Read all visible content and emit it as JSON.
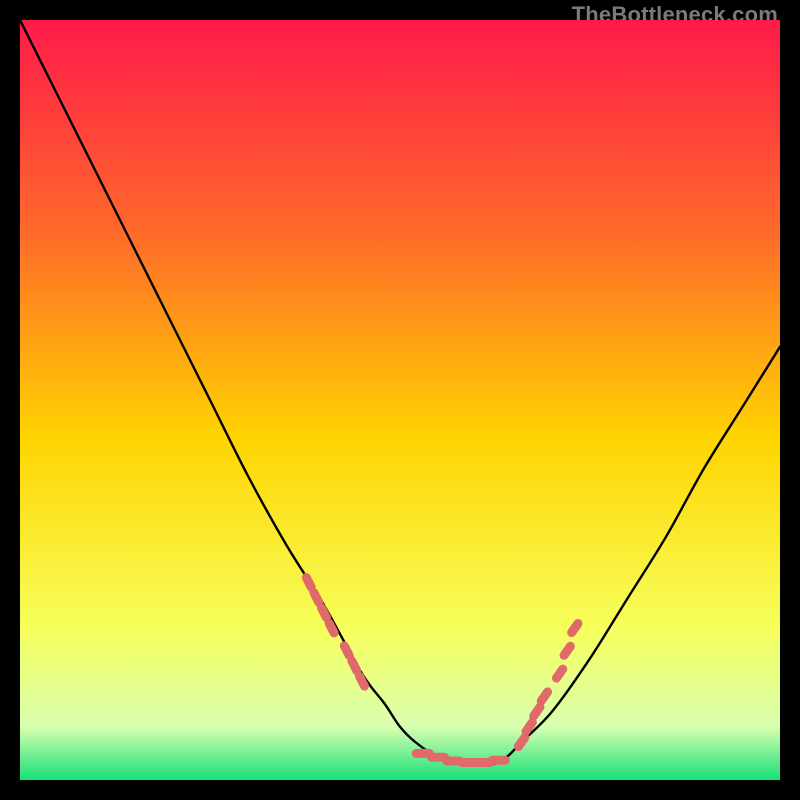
{
  "watermark": "TheBottleneck.com",
  "colors": {
    "gradient_top": "#ff1a4b",
    "gradient_upper_mid": "#ff6a2a",
    "gradient_mid": "#ffd400",
    "gradient_lower_mid": "#f6ff5b",
    "gradient_near_bottom": "#d9ffb0",
    "gradient_bottom": "#17e07a",
    "curve": "#000000",
    "marker": "#e06a6a",
    "frame": "#000000"
  },
  "chart_data": {
    "type": "line",
    "title": "",
    "xlabel": "",
    "ylabel": "",
    "xlim": [
      0,
      100
    ],
    "ylim": [
      0,
      100
    ],
    "grid": false,
    "legend": false,
    "series": [
      {
        "name": "bottleneck-curve",
        "x": [
          0,
          5,
          10,
          15,
          20,
          25,
          30,
          35,
          40,
          45,
          48,
          50,
          52,
          55,
          58,
          60,
          62,
          64,
          66,
          70,
          75,
          80,
          85,
          90,
          95,
          100
        ],
        "y": [
          100,
          90,
          80,
          70,
          60,
          50,
          40,
          31,
          23,
          14,
          10,
          7,
          5,
          3,
          2,
          2,
          2,
          3,
          5,
          9,
          16,
          24,
          32,
          41,
          49,
          57
        ]
      }
    ],
    "marker_clusters": [
      {
        "name": "left-cluster",
        "points": [
          {
            "x": 38,
            "y": 26
          },
          {
            "x": 39,
            "y": 24
          },
          {
            "x": 40,
            "y": 22
          },
          {
            "x": 41,
            "y": 20
          },
          {
            "x": 43,
            "y": 17
          },
          {
            "x": 44,
            "y": 15
          },
          {
            "x": 45,
            "y": 13
          }
        ]
      },
      {
        "name": "bottom-cluster",
        "points": [
          {
            "x": 53,
            "y": 3.5
          },
          {
            "x": 55,
            "y": 3.0
          },
          {
            "x": 57,
            "y": 2.5
          },
          {
            "x": 59,
            "y": 2.3
          },
          {
            "x": 61,
            "y": 2.3
          },
          {
            "x": 63,
            "y": 2.6
          }
        ]
      },
      {
        "name": "right-cluster",
        "points": [
          {
            "x": 66,
            "y": 5
          },
          {
            "x": 67,
            "y": 7
          },
          {
            "x": 68,
            "y": 9
          },
          {
            "x": 69,
            "y": 11
          },
          {
            "x": 71,
            "y": 14
          },
          {
            "x": 72,
            "y": 17
          },
          {
            "x": 73,
            "y": 20
          }
        ]
      }
    ]
  }
}
